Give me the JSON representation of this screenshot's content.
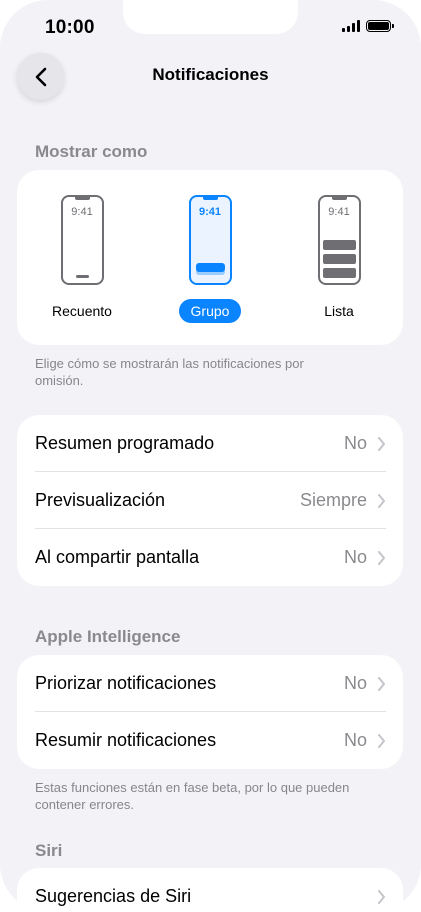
{
  "status_bar": {
    "time": "10:00"
  },
  "nav": {
    "title": "Notificaciones"
  },
  "display_as": {
    "header": "Mostrar como",
    "options": [
      {
        "label": "Recuento",
        "preview_time": "9:41",
        "selected": false
      },
      {
        "label": "Grupo",
        "preview_time": "9:41",
        "selected": true
      },
      {
        "label": "Lista",
        "preview_time": "9:41",
        "selected": false
      }
    ],
    "footnote": "Elige cómo se mostrarán las notificaciones por omisión."
  },
  "settings_group": [
    {
      "label": "Resumen programado",
      "value": "No"
    },
    {
      "label": "Previsualización",
      "value": "Siempre"
    },
    {
      "label": "Al compartir pantalla",
      "value": "No"
    }
  ],
  "apple_intelligence": {
    "header": "Apple Intelligence",
    "rows": [
      {
        "label": "Priorizar notificaciones",
        "value": "No"
      },
      {
        "label": "Resumir notificaciones",
        "value": "No"
      }
    ],
    "footnote": "Estas funciones están en fase beta, por lo que pueden contener errores."
  },
  "siri": {
    "header": "Siri",
    "rows": [
      {
        "label": "Sugerencias de Siri"
      }
    ]
  },
  "colors": {
    "accent": "#0a84ff",
    "background": "#f2f2f7",
    "secondary_text": "#8a8a8e"
  },
  "icons": [
    "back-chevron-icon",
    "signal-icon",
    "battery-icon",
    "chevron-right-icon"
  ]
}
